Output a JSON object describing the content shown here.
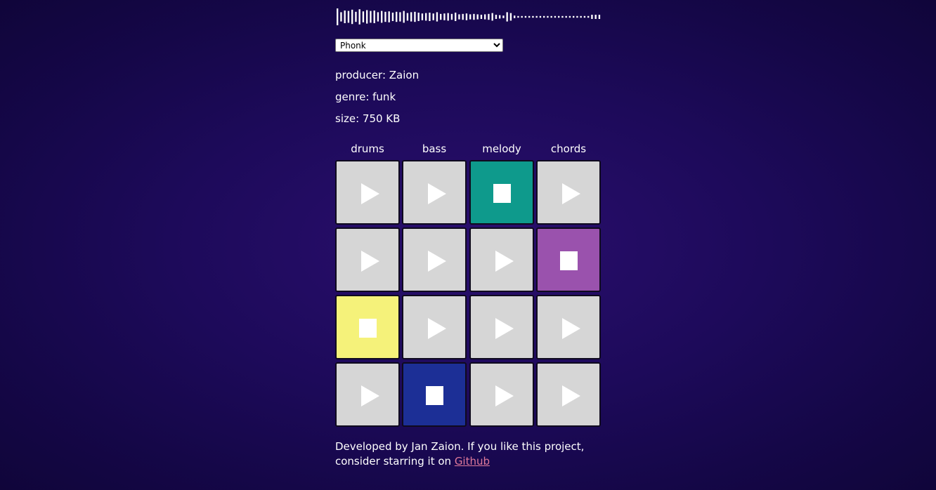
{
  "preset": {
    "selected": "Phonk",
    "options": [
      "Phonk"
    ]
  },
  "info": {
    "producer": "producer: Zaion",
    "genre": "genre: funk",
    "size": "size: 750 KB"
  },
  "columns": [
    "drums",
    "bass",
    "melody",
    "chords"
  ],
  "grid": [
    [
      {
        "state": "play"
      },
      {
        "state": "play"
      },
      {
        "state": "stop",
        "color": "#0e9a8c"
      },
      {
        "state": "play"
      }
    ],
    [
      {
        "state": "play"
      },
      {
        "state": "play"
      },
      {
        "state": "play"
      },
      {
        "state": "stop",
        "color": "#9a52ad"
      }
    ],
    [
      {
        "state": "stop",
        "color": "#f5f27a"
      },
      {
        "state": "play"
      },
      {
        "state": "play"
      },
      {
        "state": "play"
      }
    ],
    [
      {
        "state": "play"
      },
      {
        "state": "stop",
        "color": "#1c2f96"
      },
      {
        "state": "play"
      },
      {
        "state": "play"
      }
    ]
  ],
  "pad_colors": {
    "idle": "#d6d6d6"
  },
  "footer": {
    "text_line1": "Developed by Jan Zaion. If you like this project,",
    "text_line2": "consider starring it on",
    "link_label": "Github"
  },
  "visualizer": {
    "levels": [
      1.0,
      0.55,
      0.75,
      0.7,
      0.85,
      0.6,
      0.9,
      0.65,
      0.8,
      0.7,
      0.75,
      0.55,
      0.7,
      0.6,
      0.65,
      0.5,
      0.6,
      0.55,
      0.7,
      0.45,
      0.55,
      0.6,
      0.5,
      0.4,
      0.45,
      0.5,
      0.4,
      0.55,
      0.35,
      0.4,
      0.45,
      0.35,
      0.5,
      0.3,
      0.35,
      0.4,
      0.3,
      0.35,
      0.3,
      0.25,
      0.3,
      0.35,
      0.45,
      0.25,
      0.2,
      0.15,
      0.55,
      0.45,
      0.15,
      0.1,
      0.1,
      0.1,
      0.1,
      0.1,
      0.1,
      0.1,
      0.1,
      0.1,
      0.1,
      0.1,
      0.1,
      0.1,
      0.1,
      0.1,
      0.1,
      0.1,
      0.1,
      0.1,
      0.1,
      0.25,
      0.25,
      0.25
    ]
  }
}
